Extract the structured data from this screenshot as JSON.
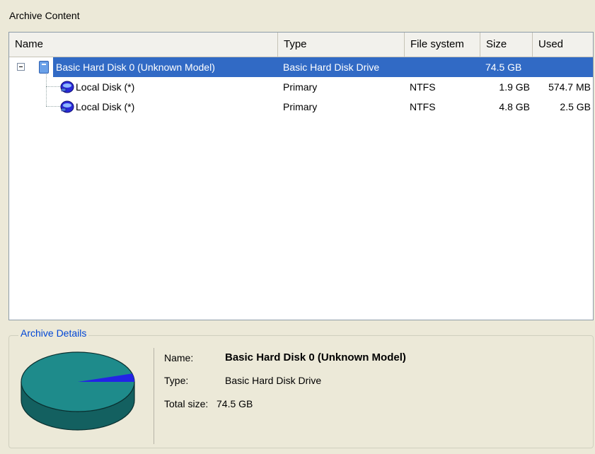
{
  "archive_content": {
    "title": "Archive Content",
    "columns": [
      "Name",
      "Type",
      "File system",
      "Size",
      "Used"
    ],
    "rows": [
      {
        "name": "Basic Hard Disk 0 (Unknown Model)",
        "type": "Basic Hard Disk Drive",
        "fs": "",
        "size": "74.5 GB",
        "used": "",
        "icon": "hard-disk-icon",
        "selected": true
      },
      {
        "name": "Local Disk (*)",
        "type": "Primary",
        "fs": "NTFS",
        "size": "1.9 GB",
        "used": "574.7 MB",
        "icon": "partition-icon",
        "selected": false
      },
      {
        "name": "Local Disk (*)",
        "type": "Primary",
        "fs": "NTFS",
        "size": "4.8 GB",
        "used": "2.5 GB",
        "icon": "partition-icon",
        "selected": false
      }
    ]
  },
  "archive_details": {
    "title": "Archive Details",
    "name_label": "Name:",
    "name_value": "Basic Hard Disk 0 (Unknown Model)",
    "type_label": "Type:",
    "type_value": "Basic Hard Disk Drive",
    "total_label": "Total size:",
    "total_value": "74.5 GB",
    "pie_used_fraction": 0.09,
    "colors": {
      "pie_free": "#1e8b8b",
      "pie_used": "#2323e6",
      "selection": "#316ac5",
      "group_title": "#0046d5"
    }
  }
}
